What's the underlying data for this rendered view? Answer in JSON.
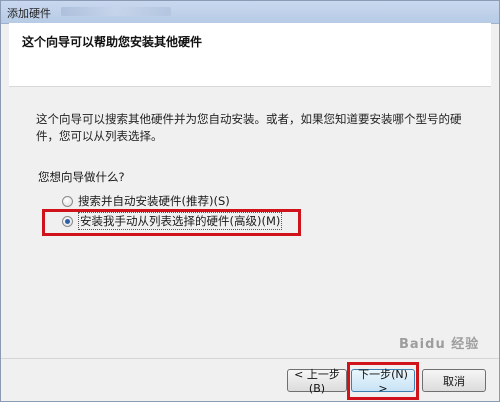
{
  "window": {
    "title": "添加硬件"
  },
  "header": {
    "title": "这个向导可以帮助您安装其他硬件"
  },
  "main": {
    "description": "这个向导可以搜索其他硬件并为您自动安装。或者，如果您知道要安装哪个型号的硬件，您可以从列表选择。",
    "question": "您想向导做什么?",
    "options": [
      {
        "label": "搜索并自动安装硬件(推荐)(S)",
        "selected": false
      },
      {
        "label": "安装我手动从列表选择的硬件(高级)(M)",
        "selected": true
      }
    ]
  },
  "buttons": {
    "back": "< 上一步(B)",
    "next": "下一步(N) >",
    "cancel": "取消"
  },
  "watermark": "Baidu 经验",
  "colors": {
    "annotation_red": "#d0121b"
  }
}
